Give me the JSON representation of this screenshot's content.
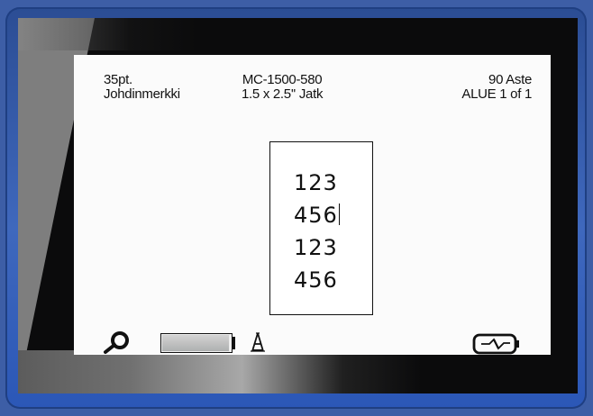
{
  "header": {
    "left": {
      "font_size": "35pt.",
      "label_type": "Johdinmerkki"
    },
    "center": {
      "part_number": "MC-1500-580",
      "size_mode": "1.5 x 2.5''  Jatk"
    },
    "right": {
      "rotation": "90 Aste",
      "area": "ALUE  1 of 1"
    }
  },
  "editor": {
    "lines": [
      "123",
      "456",
      "123",
      "456"
    ],
    "cursor_line": 2
  },
  "status": {
    "tape_remaining_fraction": 0.97,
    "icons": [
      "tape-roll-icon",
      "tape-level-gauge",
      "font-style-icon",
      "ac-power-battery-icon"
    ]
  },
  "colors": {
    "frame": "#3d5ea6",
    "bezel": "#0b0b0c",
    "screen": "#fbfbfb",
    "ink": "#111111"
  }
}
